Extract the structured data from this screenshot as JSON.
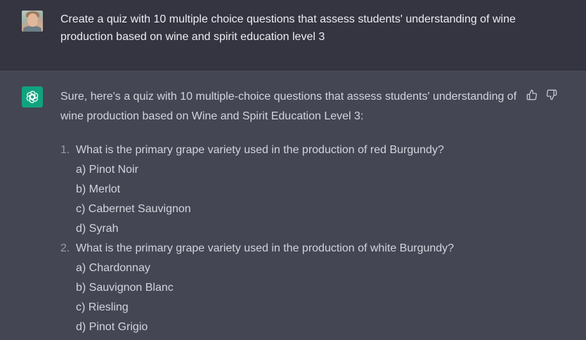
{
  "user_message": {
    "text": "Create a quiz with 10 multiple choice questions that assess students' understanding of wine production based on wine and spirit education level 3"
  },
  "assistant_message": {
    "intro": "Sure, here's a quiz with 10 multiple-choice questions that assess students' understanding of wine production based on Wine and Spirit Education Level 3:",
    "questions": [
      {
        "number": "1.",
        "text": "What is the primary grape variety used in the production of red Burgundy?",
        "options": [
          "a) Pinot Noir",
          "b) Merlot",
          "c) Cabernet Sauvignon",
          "d) Syrah"
        ]
      },
      {
        "number": "2.",
        "text": "What is the primary grape variety used in the production of white Burgundy?",
        "options": [
          "a) Chardonnay",
          "b) Sauvignon Blanc",
          "c) Riesling",
          "d) Pinot Grigio"
        ]
      }
    ]
  },
  "icons": {
    "user_avatar": "user-avatar-photo",
    "assistant_avatar": "openai-logo-icon",
    "thumbs_up": "thumbs-up-icon",
    "thumbs_down": "thumbs-down-icon"
  },
  "colors": {
    "user_bg": "#343541",
    "assistant_bg": "#444654",
    "assistant_avatar_bg": "#10a37f",
    "text": "#d1d5db"
  }
}
